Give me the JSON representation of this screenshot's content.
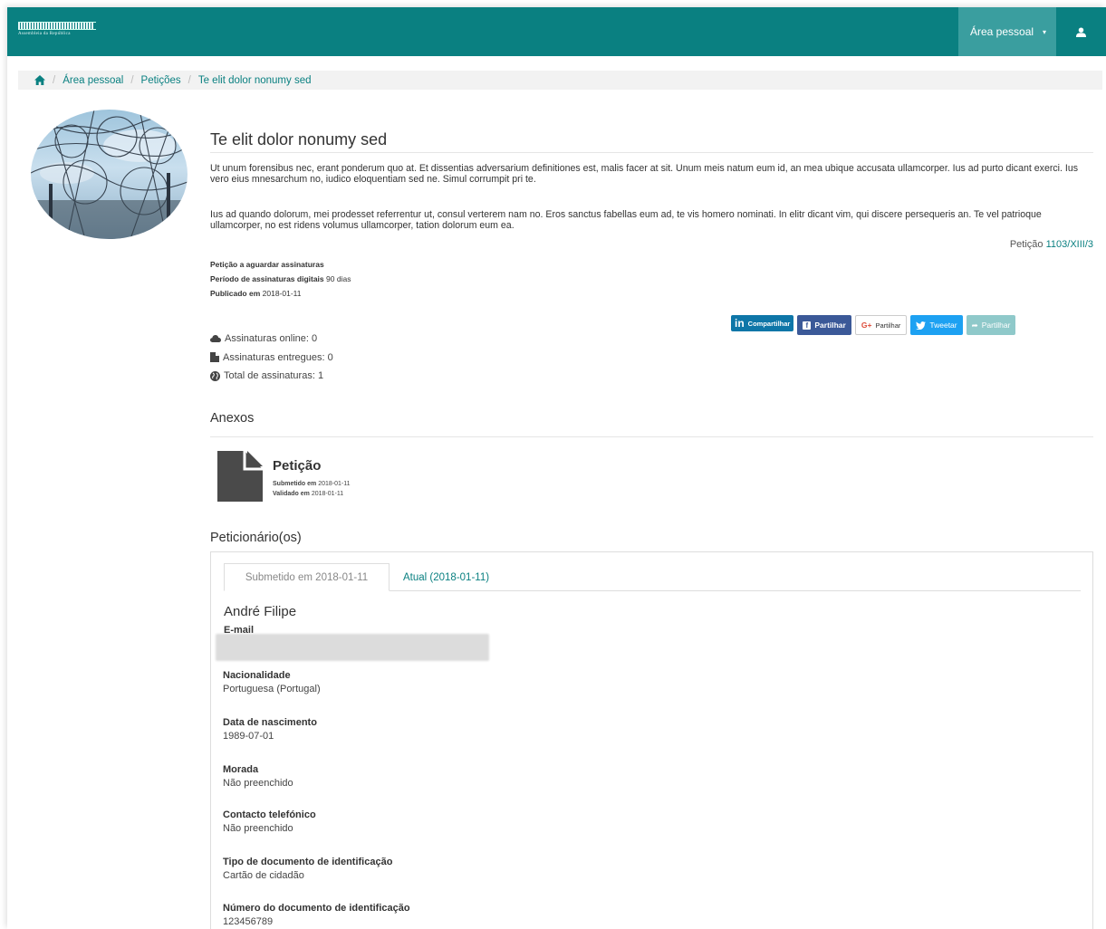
{
  "header": {
    "logo_text": "Assembleia da República",
    "menu_label": "Área pessoal",
    "caret": "▾"
  },
  "breadcrumb": {
    "items": [
      "Área pessoal",
      "Petições",
      "Te elit dolor nonumy sed"
    ],
    "separator": "/"
  },
  "petition": {
    "title": "Te elit dolor nonumy sed",
    "paragraph1": "Ut unum forensibus nec, erant ponderum quo at. Et dissentias adversarium definitiones est, malis facer at sit. Unum meis natum eum id, an mea ubique accusata ullamcorper. Ius ad purto dicant exerci. Ius vero eius mnesarchum no, iudico eloquentiam sed ne. Simul corrumpit pri te.",
    "paragraph2": "Ius ad quando dolorum, mei prodesset referrentur ut, consul verterem nam no. Eros sanctus fabellas eum ad, te vis homero nominati. In elitr dicant vim, qui discere persequeris an. Te vel patrioque ullamcorper, no est ridens volumus ullamcorper, tation dolorum eum ea.",
    "ref_prefix": "Petição",
    "ref_number": "1103/XIII/3",
    "status": "Petição a aguardar assinaturas",
    "period_label": "Período de assinaturas digitais",
    "period_value": "90 dias",
    "published_label": "Publicado em",
    "published_value": "2018-01-11"
  },
  "social": {
    "linkedin": "Compartilhar",
    "facebook": "Partilhar",
    "google": "Partilhar",
    "twitter": "Tweetar",
    "share": "Partilhar"
  },
  "counts": {
    "online": "Assinaturas online: 0",
    "delivered": "Assinaturas entregues: 0",
    "total": "Total de assinaturas: 1"
  },
  "annexes": {
    "heading": "Anexos",
    "doc_title": "Petição",
    "submitted_label": "Submetido em",
    "submitted_value": "2018-01-11",
    "validated_label": "Validado em",
    "validated_value": "2018-01-11"
  },
  "petitioners": {
    "heading": "Peticionário(os)",
    "tabs": [
      "Submetido em 2018-01-11",
      "Atual (2018-01-11)"
    ],
    "name": "André Filipe",
    "fields": [
      {
        "label": "E-mail",
        "value": ""
      },
      {
        "label": "Nacionalidade",
        "value": "Portuguesa (Portugal)"
      },
      {
        "label": "Data de nascimento",
        "value": "1989-07-01"
      },
      {
        "label": "Morada",
        "value": "Não preenchido"
      },
      {
        "label": "Contacto telefónico",
        "value": "Não preenchido"
      },
      {
        "label": "Tipo de documento de identificação",
        "value": "Cartão de cidadão"
      },
      {
        "label": "Número do documento de identificação",
        "value": "123456789"
      }
    ]
  },
  "colors": {
    "brand": "#0a8081",
    "link": "#0a8081"
  }
}
